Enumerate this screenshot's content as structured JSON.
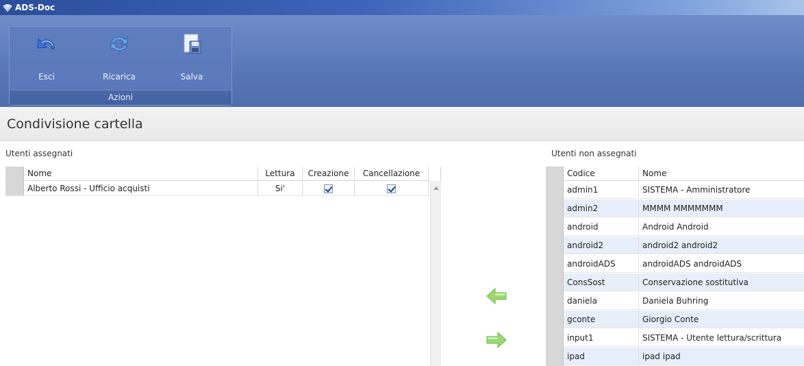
{
  "window": {
    "title": "ADS-Doc"
  },
  "ribbon": {
    "group_label": "Azioni",
    "buttons": [
      {
        "label": "Esci",
        "icon": "undo-arrow-icon"
      },
      {
        "label": "Ricarica",
        "icon": "refresh-icon"
      },
      {
        "label": "Salva",
        "icon": "save-disk-icon"
      }
    ]
  },
  "page": {
    "title": "Condivisione cartella"
  },
  "assigned": {
    "label": "Utenti assegnati",
    "columns": [
      "Nome",
      "Lettura",
      "Creazione",
      "Cancellazione"
    ],
    "rows": [
      {
        "nome": "Alberto Rossi - Ufficio acquisti",
        "lettura": "Si'",
        "creazione": true,
        "cancellazione": true
      }
    ]
  },
  "unassigned": {
    "label": "Utenti non assegnati",
    "columns": [
      "Codice",
      "Nome"
    ],
    "rows": [
      {
        "codice": "admin1",
        "nome": "SISTEMA - Amministratore"
      },
      {
        "codice": "admin2",
        "nome": "MMMM MMMMMMM"
      },
      {
        "codice": "android",
        "nome": "Android Android"
      },
      {
        "codice": "android2",
        "nome": "android2 android2"
      },
      {
        "codice": "androidADS",
        "nome": "androidADS androidADS"
      },
      {
        "codice": "ConsSost",
        "nome": "Conservazione sostitutiva"
      },
      {
        "codice": "daniela",
        "nome": "Daniela Buhring"
      },
      {
        "codice": "gconte",
        "nome": "Giorgio Conte"
      },
      {
        "codice": "input1",
        "nome": "SISTEMA - Utente lettura/scrittura"
      },
      {
        "codice": "ipad",
        "nome": "ipad ipad"
      }
    ]
  },
  "colors": {
    "titlebar": "#2a4e9b",
    "ribbon": "#5877b8",
    "row_alt": "#e6eef9",
    "arrow": "#8fd16a"
  }
}
